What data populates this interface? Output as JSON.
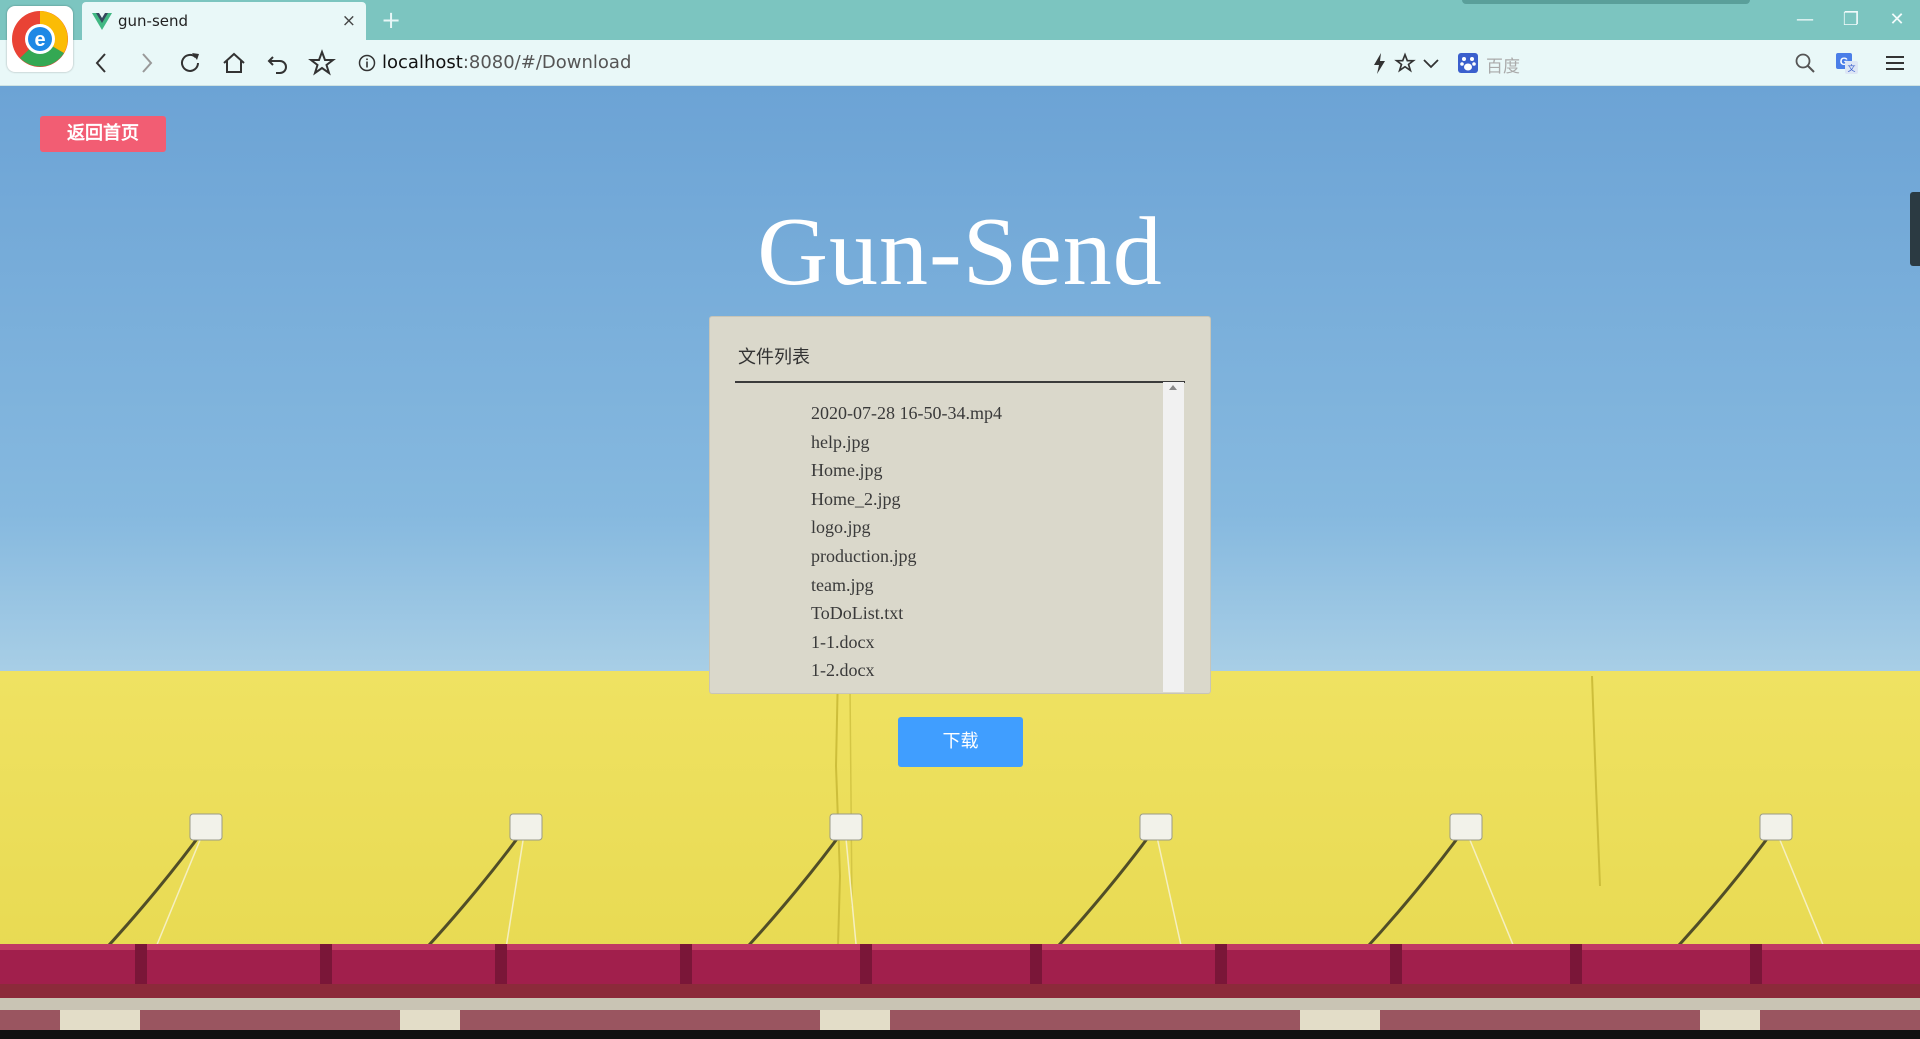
{
  "browser": {
    "tab_title": "gun-send",
    "tab_close": "×",
    "new_tab": "+",
    "window_controls": {
      "minimize": "—",
      "restore": "❐",
      "close": "✕"
    },
    "url_host": "localhost",
    "url_rest": ":8080/#/Download",
    "search_placeholder": "百度"
  },
  "page": {
    "back_home_label": "返回首页",
    "title": "Gun-Send",
    "panel_title": "文件列表",
    "files": [
      "2020-07-28 16-50-34.mp4",
      "help.jpg",
      "Home.jpg",
      "Home_2.jpg",
      "logo.jpg",
      "production.jpg",
      "team.jpg",
      "ToDoList.txt",
      "1-1.docx",
      "1-2.docx"
    ],
    "download_label": "下载"
  },
  "colors": {
    "tab_bar": "#7cc5c0",
    "nav_bar": "#e9f8f8",
    "back_button": "#f25d73",
    "download_button": "#409eff",
    "panel": "#dad8cb",
    "wall_yellow": "#ece15a",
    "awning_red": "#a11f4c"
  }
}
